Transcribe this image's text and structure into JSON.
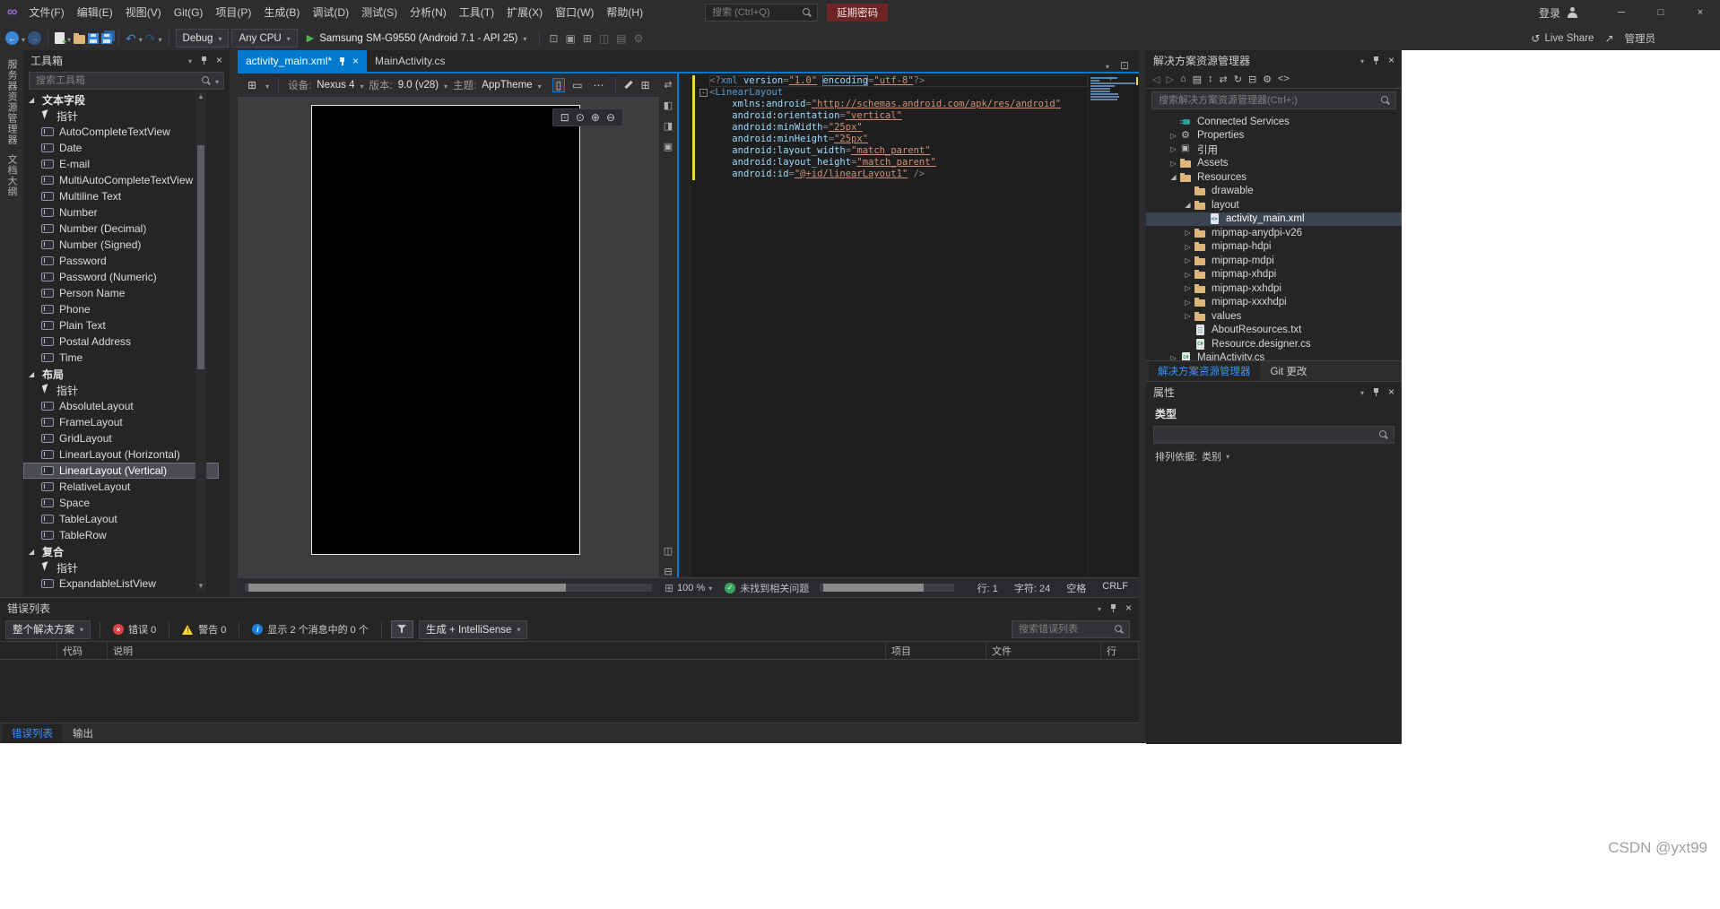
{
  "window": {
    "watermark": "CSDN @yxt99"
  },
  "title_bar": {
    "menus": [
      "文件(F)",
      "编辑(E)",
      "视图(V)",
      "Git(G)",
      "项目(P)",
      "生成(B)",
      "调试(D)",
      "测试(S)",
      "分析(N)",
      "工具(T)",
      "扩展(X)",
      "窗口(W)",
      "帮助(H)"
    ],
    "search_placeholder": "搜索 (Ctrl+Q)",
    "password_button": "延期密码",
    "sign_in": "登录"
  },
  "toolbar": {
    "debug_target": "Debug",
    "platform": "Any CPU",
    "run_target": "Samsung SM-G9550 (Android 7.1 - API 25)",
    "misc_icons": [
      "attach-debugger",
      "screenshot",
      "layout-grid",
      "device-panel",
      "columns",
      "settings"
    ],
    "live_share": "Live Share",
    "admin_label": "管理员"
  },
  "left_strip": {
    "tabs": [
      "服务器资源管理器",
      "文档大纲"
    ]
  },
  "toolbox": {
    "title": "工具箱",
    "search_placeholder": "搜索工具箱",
    "groups": [
      {
        "label": "文本字段",
        "expanded": true,
        "items": [
          "指针",
          "AutoCompleteTextView",
          "Date",
          "E-mail",
          "MultiAutoCompleteTextView",
          "Multiline Text",
          "Number",
          "Number (Decimal)",
          "Number (Signed)",
          "Password",
          "Password (Numeric)",
          "Person Name",
          "Phone",
          "Plain Text",
          "Postal Address",
          "Time"
        ]
      },
      {
        "label": "布局",
        "expanded": true,
        "selected": "LinearLayout (Vertical)",
        "items": [
          "指针",
          "AbsoluteLayout",
          "FrameLayout",
          "GridLayout",
          "LinearLayout (Horizontal)",
          "LinearLayout (Vertical)",
          "RelativeLayout",
          "Space",
          "TableLayout",
          "TableRow"
        ]
      },
      {
        "label": "复合",
        "expanded": true,
        "items": [
          "指针",
          "ExpandableListView"
        ]
      }
    ]
  },
  "editor": {
    "tabs": [
      {
        "label": "activity_main.xml*",
        "active": true
      },
      {
        "label": "MainActivity.cs",
        "active": false
      }
    ],
    "designer": {
      "left_icon": "grid-settings",
      "device_label": "设备:",
      "device": "Nexus 4",
      "version_label": "版本:",
      "version": "9.0 (v28)",
      "theme_label": "主题:",
      "theme": "AppTheme",
      "icons": [
        "portrait",
        "landscape",
        "ellipsis",
        "edit",
        "layout-grid",
        "ellipsis"
      ],
      "zoom_icons": [
        "fit-window",
        "zoom-actual",
        "zoom-in",
        "zoom-out"
      ]
    },
    "splitter_icons": {
      "top": [
        "swap-panes",
        "split-left",
        "split-right",
        "doc-view"
      ],
      "bottom": [
        "split-vertical",
        "split-horizontal"
      ]
    },
    "status": {
      "zoom": "100 %",
      "health": "未找到相关问题",
      "line": "行: 1",
      "column": "字符: 24",
      "spaces": "空格",
      "eol": "CRLF"
    },
    "code_lines": [
      {
        "current": true,
        "tokens": [
          [
            "d",
            "<?"
          ],
          [
            "t",
            "xml"
          ],
          [
            "p",
            " "
          ],
          [
            "a",
            "version"
          ],
          [
            "d",
            "="
          ],
          [
            "v",
            "\"1.0\""
          ],
          [
            "p",
            " "
          ],
          [
            "ab",
            "encoding"
          ],
          [
            "d",
            "="
          ],
          [
            "v",
            "\"utf-8\""
          ],
          [
            "d",
            "?>"
          ]
        ]
      },
      {
        "fold": true,
        "tokens": [
          [
            "d",
            "<"
          ],
          [
            "t",
            "LinearLayout"
          ]
        ]
      },
      {
        "tokens": [
          [
            "p",
            "    "
          ],
          [
            "a",
            "xmlns:android"
          ],
          [
            "d",
            "="
          ],
          [
            "v",
            "\"http://schemas.android.com/apk/res/android\""
          ]
        ]
      },
      {
        "tokens": [
          [
            "p",
            "    "
          ],
          [
            "a",
            "android:orientation"
          ],
          [
            "d",
            "="
          ],
          [
            "v",
            "\"vertical\""
          ]
        ]
      },
      {
        "tokens": [
          [
            "p",
            "    "
          ],
          [
            "a",
            "android:minWidth"
          ],
          [
            "d",
            "="
          ],
          [
            "v",
            "\"25px\""
          ]
        ]
      },
      {
        "tokens": [
          [
            "p",
            "    "
          ],
          [
            "a",
            "android:minHeight"
          ],
          [
            "d",
            "="
          ],
          [
            "v",
            "\"25px\""
          ]
        ]
      },
      {
        "tokens": [
          [
            "p",
            "    "
          ],
          [
            "a",
            "android:layout_width"
          ],
          [
            "d",
            "="
          ],
          [
            "v",
            "\"match_parent\""
          ]
        ]
      },
      {
        "tokens": [
          [
            "p",
            "    "
          ],
          [
            "a",
            "android:layout_height"
          ],
          [
            "d",
            "="
          ],
          [
            "v",
            "\"match_parent\""
          ]
        ]
      },
      {
        "tokens": [
          [
            "p",
            "    "
          ],
          [
            "a",
            "android:id"
          ],
          [
            "d",
            "="
          ],
          [
            "v",
            "\"@+id/linearLayout1\""
          ],
          [
            "d",
            " />"
          ]
        ]
      }
    ]
  },
  "solution_explorer": {
    "title": "解决方案资源管理器",
    "toolbar_icons": [
      "back",
      "forward",
      "home",
      "switch-views",
      "pending-changes",
      "sync-active",
      "refresh",
      "collapse-all",
      "properties",
      "preview-code"
    ],
    "search_placeholder": "搜索解决方案资源管理器(Ctrl+;)",
    "tree": [
      {
        "depth": 1,
        "icon": "plug",
        "label": "Connected Services"
      },
      {
        "depth": 1,
        "expand": "collapsed",
        "icon": "gear",
        "label": "Properties"
      },
      {
        "depth": 1,
        "expand": "collapsed",
        "icon": "refs",
        "label": "引用"
      },
      {
        "depth": 1,
        "expand": "collapsed",
        "icon": "folder",
        "label": "Assets"
      },
      {
        "depth": 1,
        "expand": "expanded",
        "icon": "folder",
        "label": "Resources"
      },
      {
        "depth": 2,
        "icon": "folder",
        "label": "drawable"
      },
      {
        "depth": 2,
        "expand": "expanded",
        "icon": "folder",
        "label": "layout"
      },
      {
        "depth": 3,
        "icon": "xml",
        "label": "activity_main.xml",
        "selected": true
      },
      {
        "depth": 2,
        "expand": "collapsed",
        "icon": "folder",
        "label": "mipmap-anydpi-v26"
      },
      {
        "depth": 2,
        "expand": "collapsed",
        "icon": "folder",
        "label": "mipmap-hdpi"
      },
      {
        "depth": 2,
        "expand": "collapsed",
        "icon": "folder",
        "label": "mipmap-mdpi"
      },
      {
        "depth": 2,
        "expand": "collapsed",
        "icon": "folder",
        "label": "mipmap-xhdpi"
      },
      {
        "depth": 2,
        "expand": "collapsed",
        "icon": "folder",
        "label": "mipmap-xxhdpi"
      },
      {
        "depth": 2,
        "expand": "collapsed",
        "icon": "folder",
        "label": "mipmap-xxxhdpi"
      },
      {
        "depth": 2,
        "expand": "collapsed",
        "icon": "folder",
        "label": "values"
      },
      {
        "depth": 2,
        "icon": "txt",
        "label": "AboutResources.txt"
      },
      {
        "depth": 2,
        "icon": "cs",
        "label": "Resource.designer.cs"
      },
      {
        "depth": 1,
        "expand": "collapsed",
        "icon": "cs",
        "label": "MainActivity.cs"
      }
    ],
    "tabs": [
      {
        "label": "解决方案资源管理器",
        "active": true
      },
      {
        "label": "Git 更改",
        "active": false
      }
    ]
  },
  "properties_panel": {
    "title": "属性",
    "object_type": "类型",
    "sort_label": "排列依据:",
    "sort_value": "类别"
  },
  "error_list": {
    "title": "错误列表",
    "scope": "整个解决方案",
    "errors": "错误 0",
    "warnings": "警告 0",
    "messages": "显示 2 个消息中的 0 个",
    "source": "生成 + IntelliSense",
    "search_placeholder": "搜索错误列表",
    "columns": [
      "代码",
      "说明",
      "项目",
      "文件",
      "行"
    ],
    "tabs": [
      {
        "label": "错误列表",
        "active": true
      },
      {
        "label": "输出",
        "active": false
      }
    ]
  }
}
